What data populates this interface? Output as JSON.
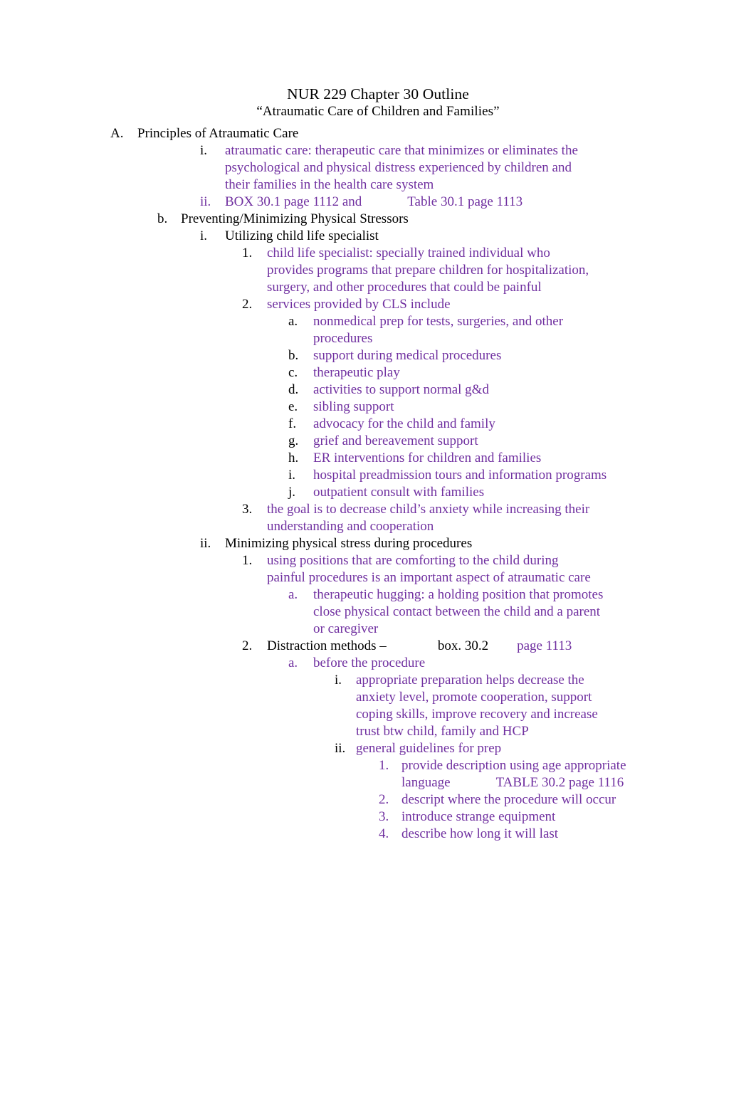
{
  "document": {
    "title": "NUR 229 Chapter 30 Outline",
    "subtitle": "“Atraumatic Care of Children and Families”",
    "colors": {
      "body_black": "#000000",
      "accent_purple": "#7030A0",
      "page_background": "#ffffff"
    }
  },
  "outline": {
    "A": {
      "marker": "A.",
      "text": "Principles of Atraumatic Care",
      "items": {
        "i": {
          "marker": "i.",
          "text": "atraumatic care: therapeutic care that minimizes or eliminates the psychological and physical distress experienced by children and their families in the health care system"
        },
        "ii": {
          "marker": "ii.",
          "text_part1": "BOX 30.1 page 1112 and",
          "text_part2": "Table 30.1 page 1113"
        }
      }
    },
    "b": {
      "marker": "b.",
      "text": "Preventing/Minimizing Physical Stressors",
      "i": {
        "marker": "i.",
        "text": "Utilizing child life specialist",
        "n1": {
          "marker": "1.",
          "text": "child life specialist: specially trained individual who provides programs that prepare children for hospitalization, surgery, and other procedures that could be painful"
        },
        "n2": {
          "marker": "2.",
          "text": "services provided by CLS include",
          "letters": [
            {
              "marker": "a.",
              "text": "nonmedical prep for tests, surgeries, and other procedures"
            },
            {
              "marker": "b.",
              "text": "support during medical procedures"
            },
            {
              "marker": "c.",
              "text": "therapeutic play"
            },
            {
              "marker": "d.",
              "text": "activities to support normal g&d"
            },
            {
              "marker": "e.",
              "text": "sibling support"
            },
            {
              "marker": "f.",
              "text": "advocacy for the child and family"
            },
            {
              "marker": "g.",
              "text": "grief and bereavement support"
            },
            {
              "marker": "h.",
              "text": "ER interventions for children and families"
            },
            {
              "marker": "i.",
              "text": "hospital preadmission tours and information programs"
            },
            {
              "marker": "j.",
              "text": "outpatient consult with families"
            }
          ]
        },
        "n3": {
          "marker": "3.",
          "text": "the goal is to decrease child’s anxiety while increasing their understanding and cooperation"
        }
      },
      "ii": {
        "marker": "ii.",
        "text": "Minimizing physical stress during procedures",
        "n1": {
          "marker": "1.",
          "text": "using positions that are comforting to the child during painful procedures is an important aspect of atraumatic care",
          "a": {
            "marker": "a.",
            "text": "therapeutic hugging: a holding position that promotes close physical contact between the child and a parent or caregiver"
          }
        },
        "n2": {
          "marker": "2.",
          "text_black1": "Distraction methods –",
          "text_black2": "box. 30.2",
          "text_purple": "page 1113",
          "a": {
            "marker": "a.",
            "text": "before the procedure",
            "roman_i": {
              "marker": "i.",
              "text": "appropriate preparation helps decrease the anxiety level, promote cooperation, support coping skills, improve recovery and increase trust btw child, family and HCP"
            },
            "roman_ii": {
              "marker": "ii.",
              "text": "general guidelines for prep",
              "numbers": [
                {
                  "marker": "1.",
                  "text_a": "provide description using age appropriate language",
                  "text_b": "TABLE 30.2 page 1116"
                },
                {
                  "marker": "2.",
                  "text": "descript where the procedure will occur"
                },
                {
                  "marker": "3.",
                  "text": "introduce strange equipment"
                },
                {
                  "marker": "4.",
                  "text": "describe how long it will last"
                }
              ]
            }
          }
        }
      }
    }
  }
}
